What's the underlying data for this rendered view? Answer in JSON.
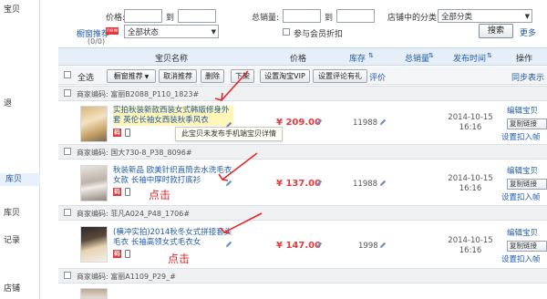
{
  "sidebar": {
    "items": [
      {
        "label": "宝贝"
      },
      {
        "label": "退"
      },
      {
        "label": "库贝"
      },
      {
        "label": "库贝"
      },
      {
        "label": "记录"
      },
      {
        "label": "店铺"
      }
    ]
  },
  "filters": {
    "price_label": "价格:",
    "price_to": "到",
    "sales_label": "总销量:",
    "sales_to": "到",
    "category_label": "店铺中的分类:",
    "category_value": "全部分类",
    "recommend_label": "橱窗推荐",
    "recommend_badge": "new",
    "recommend_count": "(0/0)",
    "status_value": "全部状态",
    "member_discount_label": "参与会员折扣",
    "search_button": "搜索",
    "more_link": "更多"
  },
  "table": {
    "headers": [
      "宝贝名称",
      "价格",
      "库存",
      "总销量",
      "发布时间",
      "操作"
    ],
    "sort_marks": [
      "",
      "",
      "⇅",
      "⇅",
      "⇅",
      ""
    ]
  },
  "toolbar": {
    "select_all": "全选",
    "recommend_button": "橱窗推荐",
    "cancel_recommend_button": "取消推荐",
    "delete_button": "删除",
    "offshelf_button": "下架",
    "vip_button": "设置淘宝VIP",
    "review_button": "设置评论有礼",
    "evaluate_link": "评价",
    "sync_link": "同步表示"
  },
  "groups": [
    {
      "merchant_code": "商家编码: 富丽B2088_P110_1823#",
      "title": "实拍秋装新款西装女式韩版修身外套 英伦长袖女西装秋季风衣",
      "title_highlight": true,
      "price": "¥ 209.00",
      "stock": "11988",
      "date": "2014-10-15",
      "time": "16:16",
      "ops": [
        "编辑宝贝",
        "复制链接",
        "设置扣入帧"
      ]
    },
    {
      "merchant_code": "商家编码: 国大730-8_P38_8096#",
      "title": "秋装新品 欧美针织直筒去水洗毛衣女款 长袖中厚时款打底衫",
      "title_highlight": false,
      "price": "¥ 137.00",
      "stock": "11988",
      "date": "2014-10-15",
      "time": "16:16",
      "ops": [
        "编辑宝贝",
        "复制链接",
        "设置扣入帧"
      ]
    },
    {
      "merchant_code": "商家编码: 菲凡A024_P48_1706#",
      "title": "(横冲实拍)2014秋冬女式拼接套头毛衣 长袖高领女式毛衣女",
      "title_highlight": false,
      "price": "¥ 147.00",
      "stock": "1998",
      "date": "2014-10-15",
      "time": "16:16",
      "ops": [
        "编辑宝贝",
        "复制链接",
        "设置扣入帧"
      ]
    },
    {
      "merchant_code": "商家编码: 富丽A1109_P29_#"
    }
  ],
  "tooltip": "此宝贝未发布手机端宝贝详情",
  "annotations": [
    "点击",
    "点击"
  ],
  "badge_text": "码",
  "colors": {
    "link": "#1f5aa8",
    "price": "#e4393c",
    "arrow": "#e0282c",
    "header_bg": "#e6eef8"
  },
  "icons": [
    "pencil-icon",
    "mobile-icon",
    "dropdown-arrow-icon",
    "checkbox-icon"
  ]
}
